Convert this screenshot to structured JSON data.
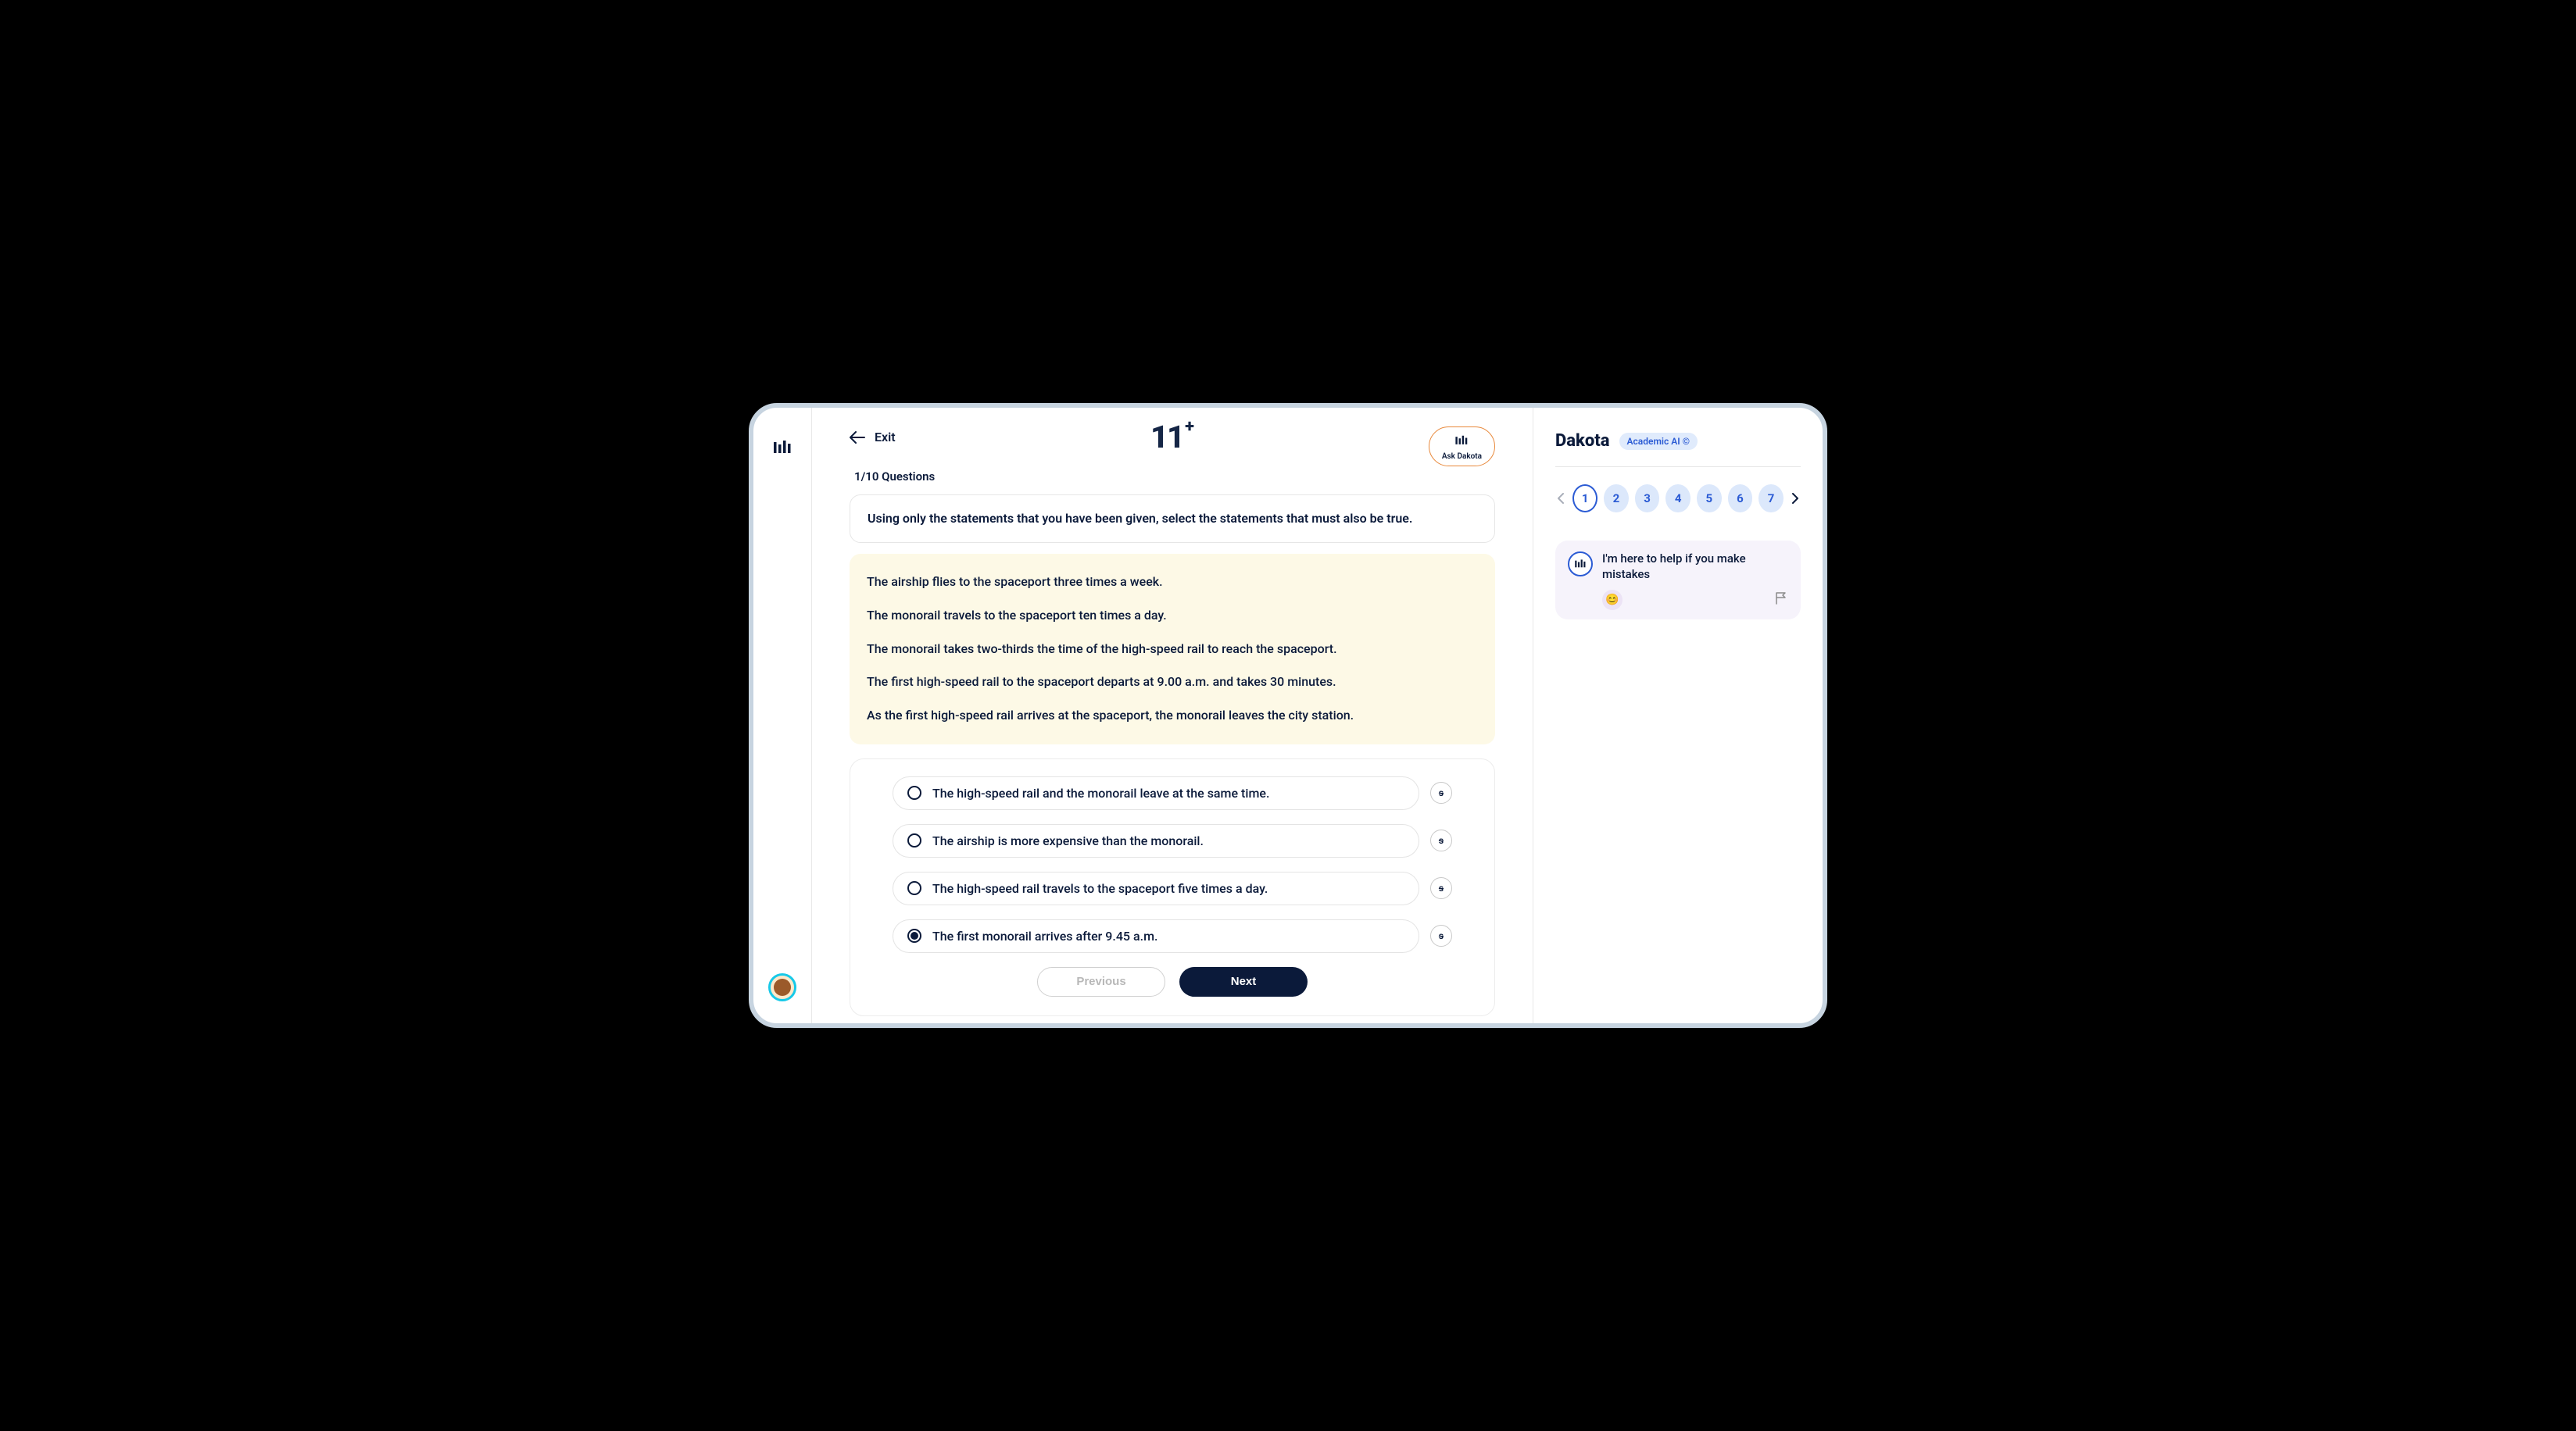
{
  "header": {
    "exit_label": "Exit",
    "logo_main": "11",
    "logo_sup": "+",
    "ask_label": "Ask Dakota"
  },
  "progress": {
    "counter": "1/10 Questions"
  },
  "question": {
    "prompt": "Using only the statements that you have been given, select the statements that must also be true.",
    "passage": [
      "The airship flies to the spaceport three times a week.",
      "The monorail travels to the spaceport ten times a day.",
      "The monorail takes two-thirds the time of the high-speed rail to reach the spaceport.",
      "The first high-speed rail to the spaceport departs at 9.00 a.m. and takes 30 minutes.",
      "As the first high-speed rail arrives at the spaceport, the monorail leaves the city station."
    ],
    "options": [
      {
        "text": "The high-speed rail and the monorail leave at the same time.",
        "selected": false
      },
      {
        "text": "The airship is more expensive than the monorail.",
        "selected": false
      },
      {
        "text": "The high-speed rail travels to the spaceport five times a day.",
        "selected": false
      },
      {
        "text": "The first monorail arrives after 9.45 a.m.",
        "selected": true
      }
    ],
    "strike_glyph": "s"
  },
  "nav": {
    "prev_label": "Previous",
    "next_label": "Next"
  },
  "sidebar": {
    "title": "Dakota",
    "badge": "Academic AI ©",
    "q_numbers": [
      "1",
      "2",
      "3",
      "4",
      "5",
      "6",
      "7"
    ],
    "active_index": 0,
    "message": "I'm here to help if you make mistakes",
    "react_emoji": "😊"
  }
}
